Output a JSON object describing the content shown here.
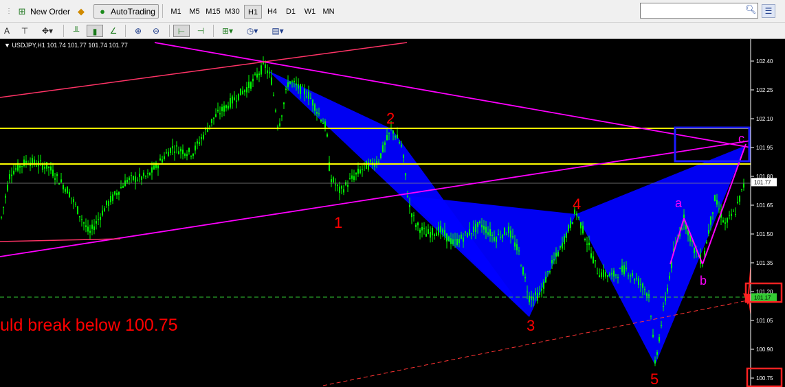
{
  "toolbar": {
    "new_order_label": "New Order",
    "autotrading_label": "AutoTrading",
    "timeframes": [
      "M1",
      "M5",
      "M15",
      "M30",
      "H1",
      "H4",
      "D1",
      "W1",
      "MN"
    ],
    "active_timeframe": "H1",
    "search_placeholder": "",
    "draw_tool_letter": "A"
  },
  "chart": {
    "header": "▼ USDJPY,H1  101.74 101.77 101.74 101.77",
    "annotation": "uld break below 100.75",
    "wave_labels": [
      "1",
      "2",
      "3",
      "4",
      "5"
    ],
    "abc_labels": [
      "a",
      "b",
      "c"
    ],
    "price_axis": [
      "102.40",
      "102.25",
      "102.10",
      "101.95",
      "101.80",
      "101.65",
      "101.50",
      "101.35",
      "101.20",
      "101.05",
      "100.90",
      "100.75"
    ],
    "price_tags": [
      "101.77",
      "101.17"
    ],
    "colors": {
      "background": "#000000",
      "candles": "#00ff00",
      "pattern_fill": "#0000ff",
      "support_lines": "#ffff00",
      "trend_lines": "#ff00ff",
      "wave_labels": "#ff0000",
      "abc_labels": "#ff00ff",
      "annotation": "#ff0000"
    }
  }
}
